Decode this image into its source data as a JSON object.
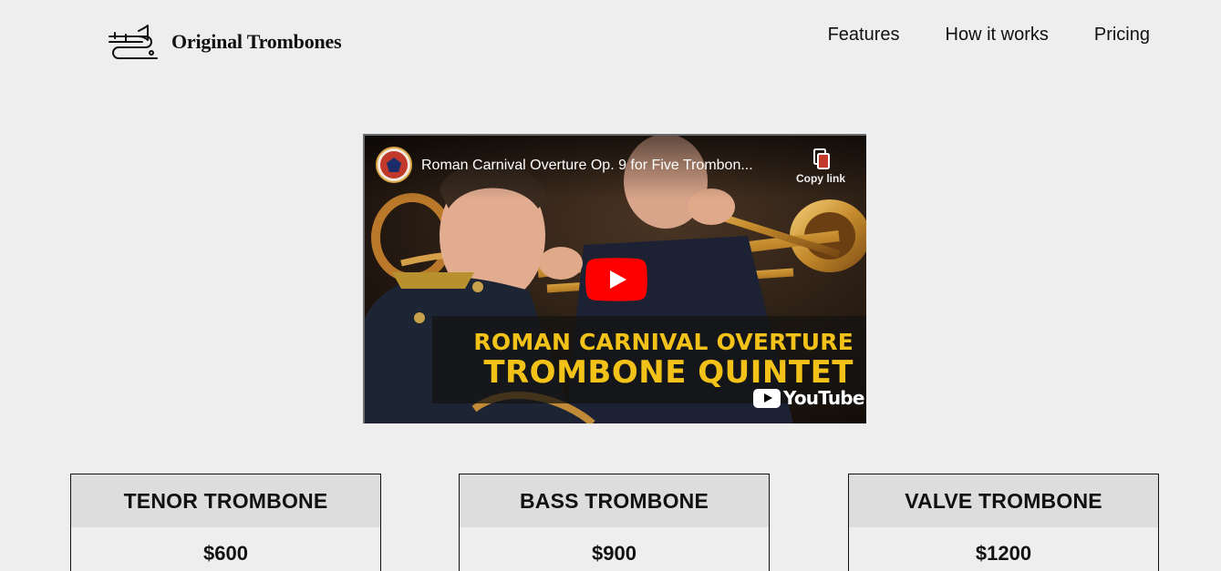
{
  "brand": {
    "name": "Original Trombones",
    "logo_icon": "trombone-icon"
  },
  "nav": {
    "items": [
      {
        "label": "Features"
      },
      {
        "label": "How it works"
      },
      {
        "label": "Pricing"
      }
    ]
  },
  "video": {
    "title": "Roman Carnival Overture Op. 9 for Five Trombon...",
    "copy_link_label": "Copy link",
    "overlay_line1": "ROMAN CARNIVAL OVERTURE",
    "overlay_line2": "TROMBONE QUINTET",
    "platform_label": "YouTube",
    "play_icon": "play-icon",
    "accent_color": "#ff0000",
    "overlay_text_color": "#f3c219"
  },
  "pricing": {
    "cards": [
      {
        "title": "TENOR TROMBONE",
        "price": "$600"
      },
      {
        "title": "BASS TROMBONE",
        "price": "$900"
      },
      {
        "title": "VALVE TROMBONE",
        "price": "$1200"
      }
    ]
  },
  "colors": {
    "page_background": "#eeeeee",
    "card_header_background": "#dddddd",
    "text": "#111111"
  }
}
